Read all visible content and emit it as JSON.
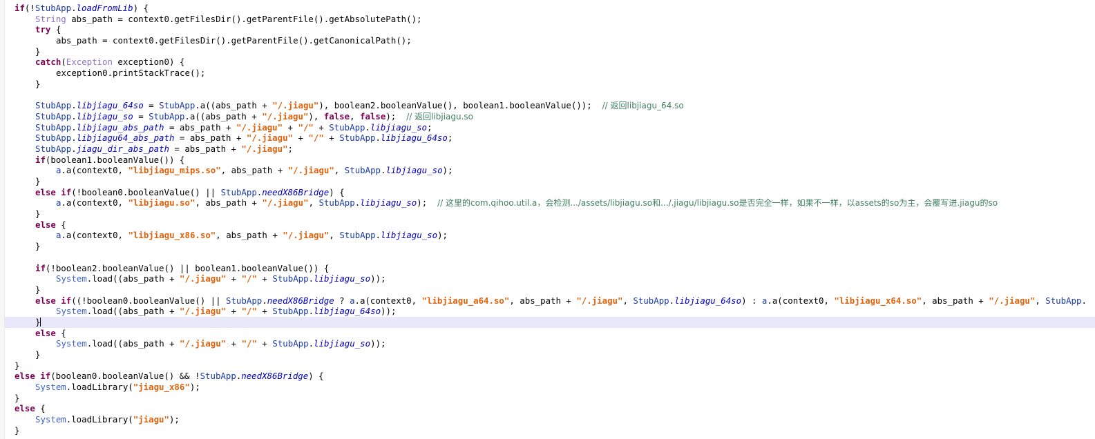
{
  "editor": {
    "lines": [
      {
        "indent": 0,
        "tokens": [
          [
            "kw",
            "if"
          ],
          [
            "",
            "(!"
          ],
          [
            "cls",
            "StubApp"
          ],
          [
            "",
            "."
          ],
          [
            "fld",
            "loadFromLib"
          ],
          [
            "",
            ") {"
          ]
        ]
      },
      {
        "indent": 1,
        "tokens": [
          [
            "tp",
            "String"
          ],
          [
            "",
            " abs_path = context0.getFilesDir().getParentFile().getAbsolutePath();"
          ]
        ]
      },
      {
        "indent": 1,
        "tokens": [
          [
            "kw",
            "try"
          ],
          [
            "",
            " {"
          ]
        ]
      },
      {
        "indent": 2,
        "tokens": [
          [
            "",
            "abs_path = context0.getFilesDir().getParentFile().getCanonicalPath();"
          ]
        ]
      },
      {
        "indent": 1,
        "tokens": [
          [
            "",
            "}"
          ]
        ]
      },
      {
        "indent": 1,
        "tokens": [
          [
            "kw",
            "catch"
          ],
          [
            "",
            "("
          ],
          [
            "tp",
            "Exception"
          ],
          [
            "",
            " exception0) {"
          ]
        ]
      },
      {
        "indent": 2,
        "tokens": [
          [
            "",
            "exception0.printStackTrace();"
          ]
        ]
      },
      {
        "indent": 1,
        "tokens": [
          [
            "",
            "}"
          ]
        ]
      },
      {
        "indent": 0,
        "tokens": []
      },
      {
        "indent": 1,
        "tokens": [
          [
            "cls",
            "StubApp"
          ],
          [
            "",
            "."
          ],
          [
            "fld",
            "libjiagu_64so"
          ],
          [
            "",
            " = "
          ],
          [
            "cls",
            "StubApp"
          ],
          [
            "",
            ".a((abs_path + "
          ],
          [
            "str",
            "\"/.jiagu\""
          ],
          [
            "",
            "), boolean2.booleanValue(), boolean1.booleanValue());  "
          ],
          [
            "cmt",
            "// 返回libjiagu_64.so"
          ]
        ]
      },
      {
        "indent": 1,
        "tokens": [
          [
            "cls",
            "StubApp"
          ],
          [
            "",
            "."
          ],
          [
            "fld",
            "libjiagu_so"
          ],
          [
            "",
            " = "
          ],
          [
            "cls",
            "StubApp"
          ],
          [
            "",
            ".a((abs_path + "
          ],
          [
            "str",
            "\"/.jiagu\""
          ],
          [
            "",
            "), "
          ],
          [
            "kw",
            "false"
          ],
          [
            "",
            ", "
          ],
          [
            "kw",
            "false"
          ],
          [
            "",
            ");  "
          ],
          [
            "cmt",
            "// 返回libjiagu.so"
          ]
        ]
      },
      {
        "indent": 1,
        "tokens": [
          [
            "cls",
            "StubApp"
          ],
          [
            "",
            "."
          ],
          [
            "fld",
            "libjiagu_abs_path"
          ],
          [
            "",
            " = abs_path + "
          ],
          [
            "str",
            "\"/.jiagu\""
          ],
          [
            "",
            " + "
          ],
          [
            "str",
            "\"/\""
          ],
          [
            "",
            " + "
          ],
          [
            "cls",
            "StubApp"
          ],
          [
            "",
            "."
          ],
          [
            "fld",
            "libjiagu_so"
          ],
          [
            "",
            ";"
          ]
        ]
      },
      {
        "indent": 1,
        "tokens": [
          [
            "cls",
            "StubApp"
          ],
          [
            "",
            "."
          ],
          [
            "fld",
            "libjiagu64_abs_path"
          ],
          [
            "",
            " = abs_path + "
          ],
          [
            "str",
            "\"/.jiagu\""
          ],
          [
            "",
            " + "
          ],
          [
            "str",
            "\"/\""
          ],
          [
            "",
            " + "
          ],
          [
            "cls",
            "StubApp"
          ],
          [
            "",
            "."
          ],
          [
            "fld",
            "libjiagu_64so"
          ],
          [
            "",
            ";"
          ]
        ]
      },
      {
        "indent": 1,
        "tokens": [
          [
            "cls",
            "StubApp"
          ],
          [
            "",
            "."
          ],
          [
            "fld",
            "jiagu_dir_abs_path"
          ],
          [
            "",
            " = abs_path + "
          ],
          [
            "str",
            "\"/.jiagu\""
          ],
          [
            "",
            ";"
          ]
        ]
      },
      {
        "indent": 1,
        "tokens": [
          [
            "kw",
            "if"
          ],
          [
            "",
            "(boolean1.booleanValue()) {"
          ]
        ]
      },
      {
        "indent": 2,
        "tokens": [
          [
            "cls",
            "a"
          ],
          [
            "",
            ".a(context0, "
          ],
          [
            "str",
            "\"libjiagu_mips.so\""
          ],
          [
            "",
            ", abs_path + "
          ],
          [
            "str",
            "\"/.jiagu\""
          ],
          [
            "",
            ", "
          ],
          [
            "cls",
            "StubApp"
          ],
          [
            "",
            "."
          ],
          [
            "fld",
            "libjiagu_so"
          ],
          [
            "",
            ");"
          ]
        ]
      },
      {
        "indent": 1,
        "tokens": [
          [
            "",
            "}"
          ]
        ]
      },
      {
        "indent": 1,
        "tokens": [
          [
            "kw",
            "else if"
          ],
          [
            "",
            "(!boolean0.booleanValue() || "
          ],
          [
            "cls",
            "StubApp"
          ],
          [
            "",
            "."
          ],
          [
            "fld",
            "needX86Bridge"
          ],
          [
            "",
            ") {"
          ]
        ]
      },
      {
        "indent": 2,
        "tokens": [
          [
            "cls",
            "a"
          ],
          [
            "",
            ".a(context0, "
          ],
          [
            "str",
            "\"libjiagu.so\""
          ],
          [
            "",
            ", abs_path + "
          ],
          [
            "str",
            "\"/.jiagu\""
          ],
          [
            "",
            ", "
          ],
          [
            "cls",
            "StubApp"
          ],
          [
            "",
            "."
          ],
          [
            "fld",
            "libjiagu_so"
          ],
          [
            "",
            ");  "
          ],
          [
            "cmt",
            "// 这里的com.qihoo.util.a，会检测.../assets/libjiagu.so和.../.jiagu/libjiagu.so是否完全一样，如果不一样，以assets的so为主，会覆写进.jiagu的so"
          ]
        ]
      },
      {
        "indent": 1,
        "tokens": [
          [
            "",
            "}"
          ]
        ]
      },
      {
        "indent": 1,
        "tokens": [
          [
            "kw",
            "else"
          ],
          [
            "",
            " {"
          ]
        ]
      },
      {
        "indent": 2,
        "tokens": [
          [
            "cls",
            "a"
          ],
          [
            "",
            ".a(context0, "
          ],
          [
            "str",
            "\"libjiagu_x86.so\""
          ],
          [
            "",
            ", abs_path + "
          ],
          [
            "str",
            "\"/.jiagu\""
          ],
          [
            "",
            ", "
          ],
          [
            "cls",
            "StubApp"
          ],
          [
            "",
            "."
          ],
          [
            "fld",
            "libjiagu_so"
          ],
          [
            "",
            ");"
          ]
        ]
      },
      {
        "indent": 1,
        "tokens": [
          [
            "",
            "}"
          ]
        ]
      },
      {
        "indent": 0,
        "tokens": []
      },
      {
        "indent": 1,
        "tokens": [
          [
            "kw",
            "if"
          ],
          [
            "",
            "(!boolean2.booleanValue() || boolean1.booleanValue()) {"
          ]
        ]
      },
      {
        "indent": 2,
        "tokens": [
          [
            "sys",
            "System"
          ],
          [
            "",
            ".load((abs_path + "
          ],
          [
            "str",
            "\"/.jiagu\""
          ],
          [
            "",
            " + "
          ],
          [
            "str",
            "\"/\""
          ],
          [
            "",
            " + "
          ],
          [
            "cls",
            "StubApp"
          ],
          [
            "",
            "."
          ],
          [
            "fld",
            "libjiagu_so"
          ],
          [
            "",
            "));"
          ]
        ]
      },
      {
        "indent": 1,
        "tokens": [
          [
            "",
            "}"
          ]
        ]
      },
      {
        "indent": 1,
        "tokens": [
          [
            "kw",
            "else if"
          ],
          [
            "",
            "((!boolean0.booleanValue() || "
          ],
          [
            "cls",
            "StubApp"
          ],
          [
            "",
            "."
          ],
          [
            "fld",
            "needX86Bridge"
          ],
          [
            "",
            " ? "
          ],
          [
            "cls",
            "a"
          ],
          [
            "",
            ".a(context0, "
          ],
          [
            "str",
            "\"libjiagu_a64.so\""
          ],
          [
            "",
            ", abs_path + "
          ],
          [
            "str",
            "\"/.jiagu\""
          ],
          [
            "",
            ", "
          ],
          [
            "cls",
            "StubApp"
          ],
          [
            "",
            "."
          ],
          [
            "fld",
            "libjiagu_64so"
          ],
          [
            "",
            ") : "
          ],
          [
            "cls",
            "a"
          ],
          [
            "",
            ".a(context0, "
          ],
          [
            "str",
            "\"libjiagu_x64.so\""
          ],
          [
            "",
            ", abs_path + "
          ],
          [
            "str",
            "\"/.jiagu\""
          ],
          [
            "",
            ", "
          ],
          [
            "cls",
            "StubApp"
          ],
          [
            "",
            "."
          ]
        ]
      },
      {
        "indent": 2,
        "tokens": [
          [
            "sys",
            "System"
          ],
          [
            "",
            ".load((abs_path + "
          ],
          [
            "str",
            "\"/.jiagu\""
          ],
          [
            "",
            " + "
          ],
          [
            "str",
            "\"/\""
          ],
          [
            "",
            " + "
          ],
          [
            "cls",
            "StubApp"
          ],
          [
            "",
            "."
          ],
          [
            "fld",
            "libjiagu_64so"
          ],
          [
            "",
            "));"
          ]
        ]
      },
      {
        "indent": 1,
        "current": true,
        "tokens": [
          [
            "",
            "}"
          ]
        ]
      },
      {
        "indent": 1,
        "tokens": [
          [
            "kw",
            "else"
          ],
          [
            "",
            " {"
          ]
        ]
      },
      {
        "indent": 2,
        "tokens": [
          [
            "sys",
            "System"
          ],
          [
            "",
            ".load((abs_path + "
          ],
          [
            "str",
            "\"/.jiagu\""
          ],
          [
            "",
            " + "
          ],
          [
            "str",
            "\"/\""
          ],
          [
            "",
            " + "
          ],
          [
            "cls",
            "StubApp"
          ],
          [
            "",
            "."
          ],
          [
            "fld",
            "libjiagu_so"
          ],
          [
            "",
            "));"
          ]
        ]
      },
      {
        "indent": 1,
        "tokens": [
          [
            "",
            "}"
          ]
        ]
      },
      {
        "indent": 0,
        "tokens": [
          [
            "",
            "}"
          ]
        ]
      },
      {
        "indent": 0,
        "tokens": [
          [
            "kw",
            "else if"
          ],
          [
            "",
            "(boolean0.booleanValue() && !"
          ],
          [
            "cls",
            "StubApp"
          ],
          [
            "",
            "."
          ],
          [
            "fld",
            "needX86Bridge"
          ],
          [
            "",
            ") {"
          ]
        ]
      },
      {
        "indent": 1,
        "tokens": [
          [
            "sys",
            "System"
          ],
          [
            "",
            ".loadLibrary("
          ],
          [
            "str",
            "\"jiagu_x86\""
          ],
          [
            "",
            ");"
          ]
        ]
      },
      {
        "indent": 0,
        "tokens": [
          [
            "",
            "}"
          ]
        ]
      },
      {
        "indent": 0,
        "tokens": [
          [
            "kw",
            "else"
          ],
          [
            "",
            " {"
          ]
        ]
      },
      {
        "indent": 1,
        "tokens": [
          [
            "sys",
            "System"
          ],
          [
            "",
            ".loadLibrary("
          ],
          [
            "str",
            "\"jiagu\""
          ],
          [
            "",
            ");"
          ]
        ]
      },
      {
        "indent": 0,
        "tokens": [
          [
            "",
            "}"
          ]
        ]
      }
    ]
  }
}
